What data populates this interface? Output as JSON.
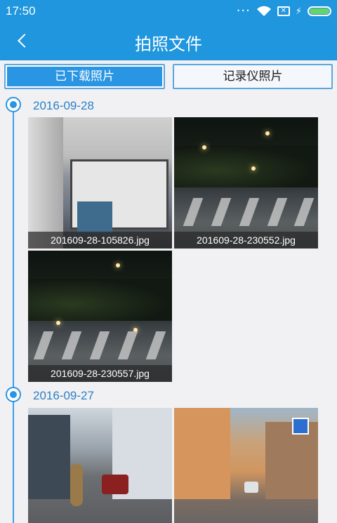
{
  "status_bar": {
    "time": "17:50",
    "icons": [
      "dots-icon",
      "wifi-icon",
      "sim-icon",
      "charging-icon",
      "battery-icon"
    ],
    "battery_color": "#65d46b"
  },
  "header": {
    "title": "拍照文件",
    "back_icon": "chevron-left-icon",
    "color": "#1f96de"
  },
  "tabs": [
    {
      "label": "已下载照片",
      "active": true
    },
    {
      "label": "记录仪照片",
      "active": false
    }
  ],
  "groups": [
    {
      "date": "2016-09-28",
      "photos": [
        {
          "filename": "201609-28-105826.jpg"
        },
        {
          "filename": "201609-28-230552.jpg"
        },
        {
          "filename": "201609-28-230557.jpg"
        }
      ]
    },
    {
      "date": "2016-09-27",
      "photos": [
        {
          "filename": ""
        },
        {
          "filename": ""
        }
      ]
    }
  ],
  "accent_color": "#2a95e3"
}
